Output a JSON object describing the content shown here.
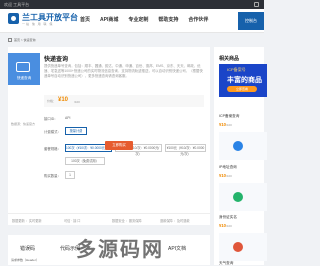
{
  "topbar": {
    "welcome": "欢迎 工具平台"
  },
  "header": {
    "brand": "兰工具开放平台",
    "brand_sub": "一站 信 用 联 保",
    "menu": [
      "首页",
      "API商城",
      "专业定制",
      "帮助支持",
      "合作伙伴"
    ],
    "cta": "控制台"
  },
  "breadcrumb": {
    "home": "首页",
    "separator": ">",
    "current": "快递查询"
  },
  "product": {
    "thumb_caption": "快递查询",
    "thumb_note": "数据源：快递官方",
    "title": "快递查询",
    "description": "提供快递单号查询，包括：顺丰、圆通、韵达、中通、申通、百世、德邦、EMS、京东、天天、邮政、优速、宅急送等1000+快递公司的实时物流信息查询，支持物流轨迹推送，可以自动识别快递公司，（根据快递单号自动识别快递公司），更多快递查询请咨询客服。",
    "price_label": "价格：",
    "price_value": "¥10",
    "price_unit": "/100",
    "interface_label": "接口ID：",
    "interface_value": "API",
    "billing_label": "计费模式：",
    "billing_option": "按量计费",
    "package_label": "套餐规格：",
    "packages": [
      "100次（¥10/次：¥0.0000元/次）",
      "1000次（¥10/次：¥0.0000元/次）",
      "¥100元（¥10/次：¥0.0000元/次）",
      "100次（免费试用）"
    ],
    "qty_label": "购买数量：",
    "qty_value": "1",
    "buy_button": "立即购买"
  },
  "service": {
    "items": [
      "数据更新 ：实时更新",
      "可信 · 接 口",
      "数据安全 ：服务保障",
      "退款保障 ：及时退款"
    ]
  },
  "tabs": [
    "错误码",
    "代码示例",
    "API文档"
  ],
  "watermark": "多源码网",
  "doc_header": "请求参数（Header）",
  "sidebar": {
    "heading": "相关商品",
    "banner": {
      "line1": "ICP备案号",
      "line2": "丰富的商品",
      "button": "立即查看"
    },
    "items": [
      {
        "name": "ICP备案查询",
        "price": "¥10",
        "unit": "/100",
        "color": "#f08a00"
      },
      {
        "name": "IP地址查询",
        "price": "¥10",
        "unit": "/100",
        "color": "#2a83e6"
      },
      {
        "name": "身份证实名",
        "price": "¥10",
        "unit": "/100",
        "color": "#24b36b"
      },
      {
        "name": "天气查询",
        "price": "",
        "unit": "",
        "color": "#e0563a"
      }
    ]
  }
}
